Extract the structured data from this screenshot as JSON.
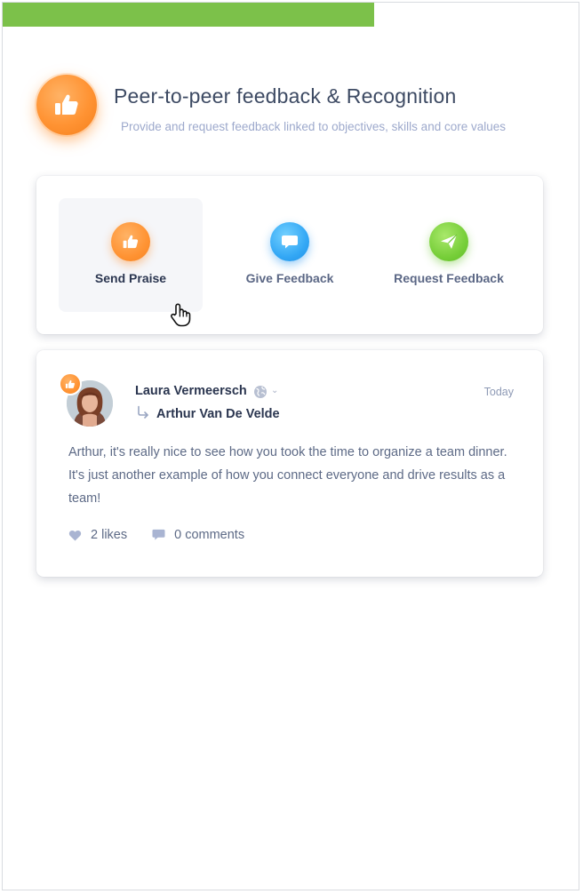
{
  "progress": {
    "fraction": 0.645,
    "color": "#7cc14a"
  },
  "header": {
    "icon": "thumbs-up-icon",
    "title": "Peer-to-peer feedback & Recognition",
    "subtitle": "Provide and request feedback linked to objectives, skills and core values"
  },
  "actions": [
    {
      "label": "Send Praise",
      "icon": "thumbs-up-icon",
      "color": "#ff9333",
      "active": true
    },
    {
      "label": "Give Feedback",
      "icon": "chat-bubble-icon",
      "color": "#34a8f5",
      "active": false
    },
    {
      "label": "Request Feedback",
      "icon": "paper-plane-icon",
      "color": "#78cf3a",
      "active": false
    }
  ],
  "post": {
    "author": "Laura Vermeersch",
    "recipient": "Arthur Van De Velde",
    "time": "Today",
    "visibility_icon": "globe-icon",
    "body": "Arthur, it's really nice to see how you took the time to organize a team dinner. It's just another example of how you connect everyone and drive results as a team!",
    "likes_label": "2 likes",
    "comments_label": "0 comments"
  }
}
